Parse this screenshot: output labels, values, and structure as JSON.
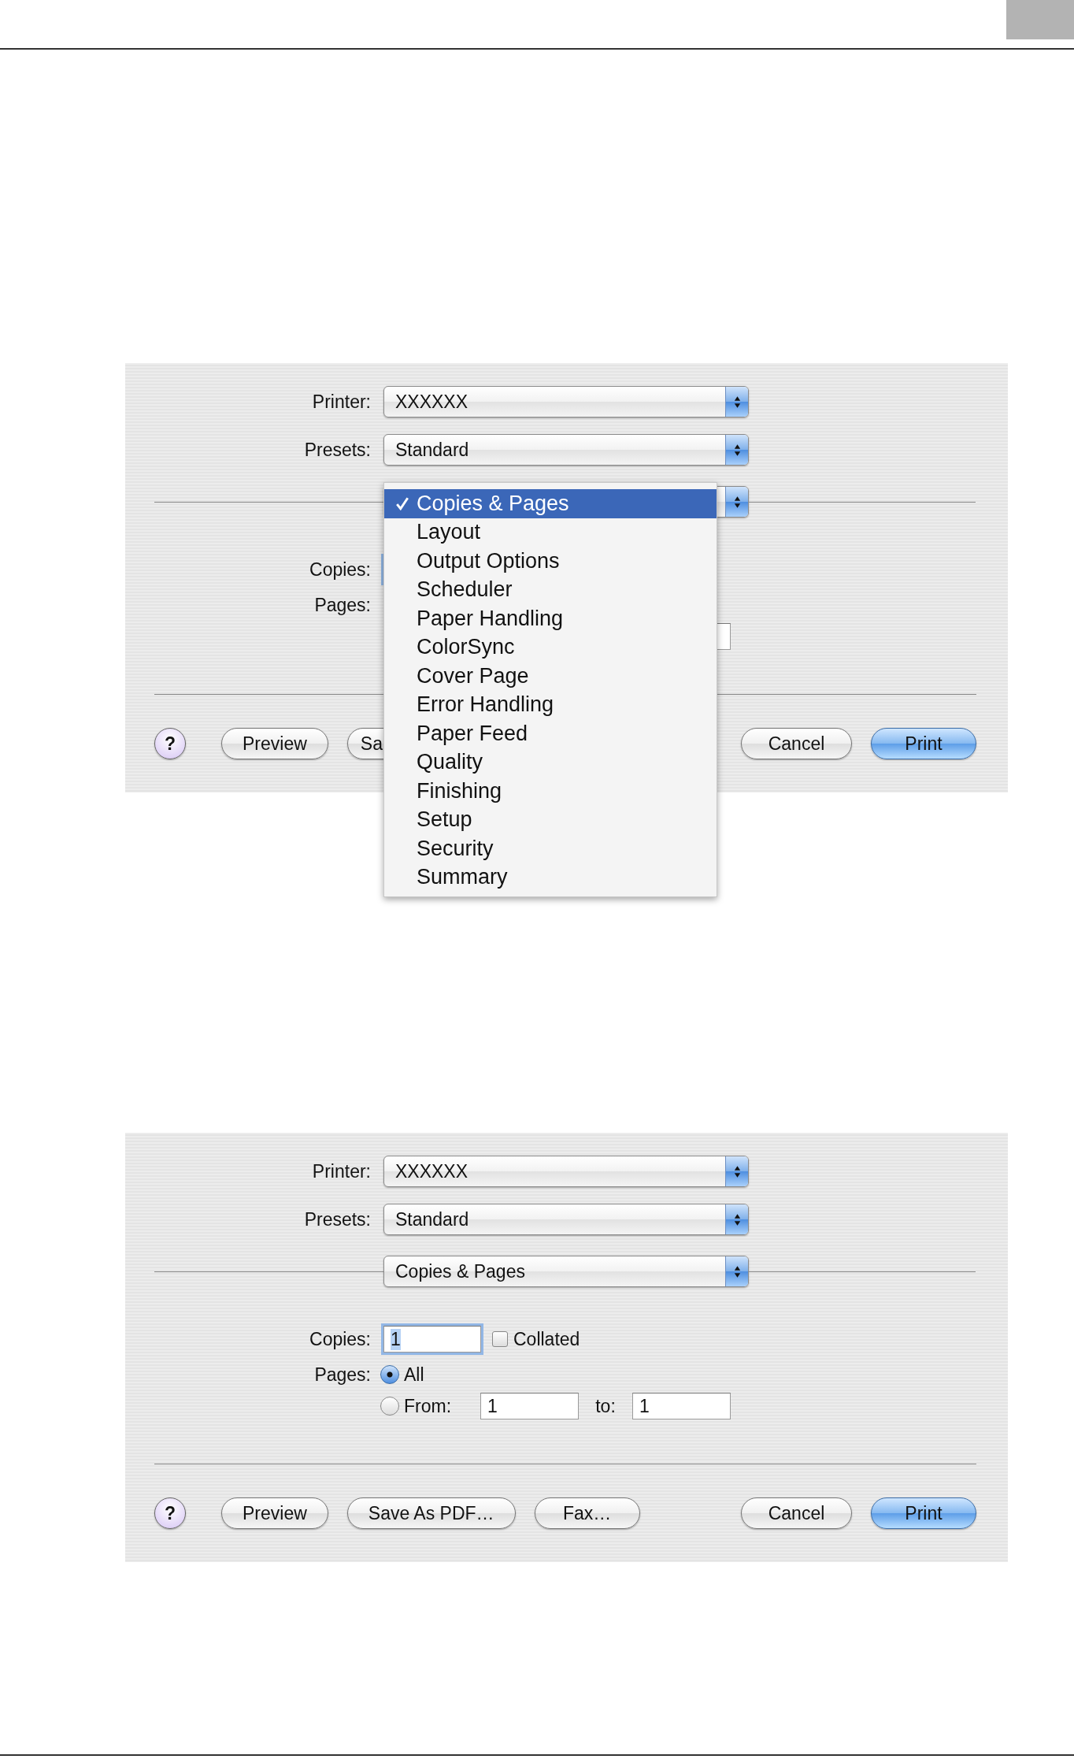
{
  "dialogs": [
    {
      "printer": {
        "label": "Printer:",
        "value": "XXXXXX"
      },
      "presets": {
        "label": "Presets:",
        "value": "Standard"
      },
      "copies": {
        "label": "Copies:"
      },
      "pages": {
        "label": "Pages:"
      },
      "left_buttons": [
        {
          "kind": "help",
          "label": "?"
        },
        {
          "kind": "push",
          "label": "Preview"
        },
        {
          "kind": "cut",
          "label": "Sa"
        }
      ],
      "right_buttons": [
        {
          "kind": "push",
          "label": "Cancel"
        },
        {
          "kind": "default",
          "label": "Print"
        }
      ],
      "menu": {
        "items": [
          {
            "label": "Copies & Pages",
            "checked": true,
            "selected": true
          },
          {
            "label": "Layout",
            "checked": false,
            "selected": false
          },
          {
            "label": "Output Options",
            "checked": false,
            "selected": false
          },
          {
            "label": "Scheduler",
            "checked": false,
            "selected": false
          },
          {
            "label": "Paper Handling",
            "checked": false,
            "selected": false
          },
          {
            "label": "ColorSync",
            "checked": false,
            "selected": false
          },
          {
            "label": "Cover Page",
            "checked": false,
            "selected": false
          },
          {
            "label": "Error Handling",
            "checked": false,
            "selected": false
          },
          {
            "label": "Paper Feed",
            "checked": false,
            "selected": false
          },
          {
            "label": "Quality",
            "checked": false,
            "selected": false
          },
          {
            "label": "Finishing",
            "checked": false,
            "selected": false
          },
          {
            "label": "Setup",
            "checked": false,
            "selected": false
          },
          {
            "label": "Security",
            "checked": false,
            "selected": false
          },
          {
            "label": "Summary",
            "checked": false,
            "selected": false
          }
        ]
      }
    },
    {
      "printer": {
        "label": "Printer:",
        "value": "XXXXXX"
      },
      "presets": {
        "label": "Presets:",
        "value": "Standard"
      },
      "panel": {
        "value": "Copies & Pages"
      },
      "copies": {
        "label": "Copies:",
        "value": "1",
        "collated": {
          "label": "Collated",
          "checked": false
        }
      },
      "pages": {
        "label": "Pages:",
        "options": [
          {
            "label": "All",
            "selected": true
          },
          {
            "label": "From:",
            "selected": false
          }
        ],
        "from": "1",
        "to_label": "to:",
        "to": "1"
      },
      "left_buttons": [
        {
          "kind": "help",
          "label": "?"
        },
        {
          "kind": "push",
          "label": "Preview"
        },
        {
          "kind": "push",
          "label": "Save As PDF…"
        },
        {
          "kind": "push",
          "label": "Fax…"
        }
      ],
      "right_buttons": [
        {
          "kind": "push",
          "label": "Cancel"
        },
        {
          "kind": "default",
          "label": "Print"
        }
      ]
    }
  ]
}
